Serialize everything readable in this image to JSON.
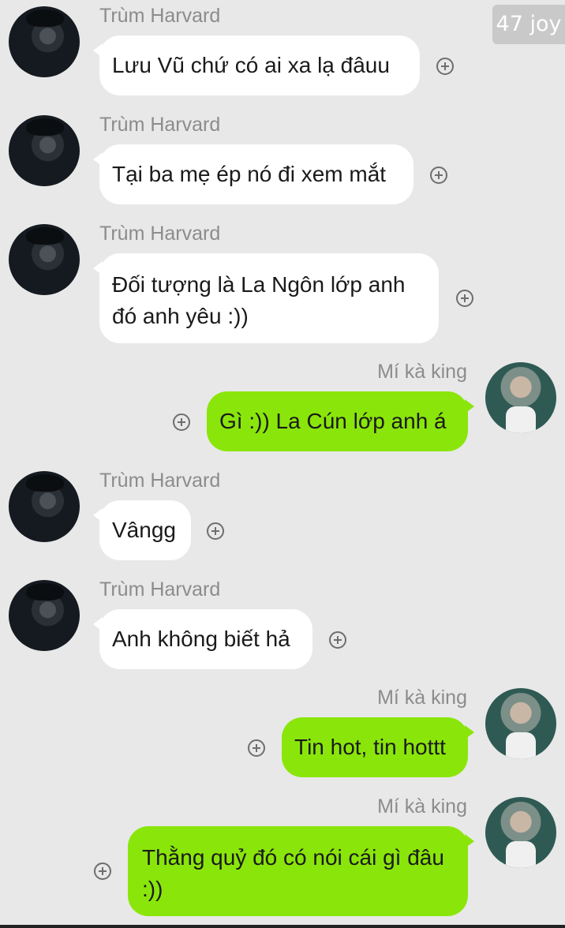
{
  "header": {
    "badge": "47 joy"
  },
  "messages": [
    {
      "sender": "Trùm Harvard",
      "text": "Lưu Vũ chứ có ai xa lạ đâuu"
    },
    {
      "sender": "Trùm Harvard",
      "text": "Tại ba mẹ ép nó đi xem mắt"
    },
    {
      "sender": "Trùm Harvard",
      "text": "Đối tượng là La Ngôn lớp anh đó anh yêu :))"
    },
    {
      "sender": "Mí kà king",
      "text": "Gì :)) La Cún lớp anh á"
    },
    {
      "sender": "Trùm Harvard",
      "text": "Vângg"
    },
    {
      "sender": "Trùm Harvard",
      "text": "Anh không biết hả"
    },
    {
      "sender": "Mí kà king",
      "text": "Tin hot, tin hottt"
    },
    {
      "sender": "Mí kà king",
      "text": "Thằng quỷ đó có nói cái gì đâu :))"
    }
  ],
  "colors": {
    "incoming_bubble": "#ffffff",
    "outgoing_bubble": "#8ae60a",
    "background": "#e8e8e8"
  }
}
